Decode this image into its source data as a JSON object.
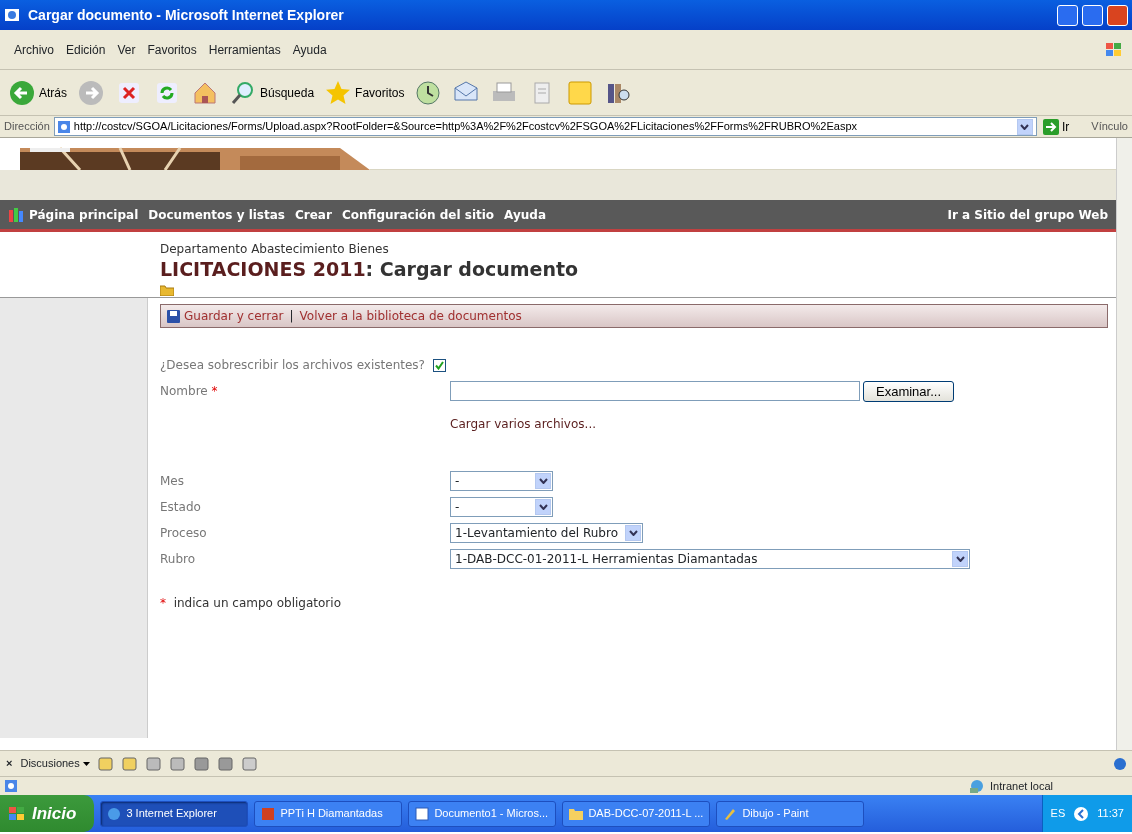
{
  "window": {
    "title": "Cargar documento - Microsoft Internet Explorer"
  },
  "menu": [
    "Archivo",
    "Edición",
    "Ver",
    "Favoritos",
    "Herramientas",
    "Ayuda"
  ],
  "toolbar": [
    {
      "kind": "back",
      "label": "Atrás"
    },
    {
      "kind": "forward"
    },
    {
      "kind": "stop"
    },
    {
      "kind": "refresh"
    },
    {
      "kind": "home"
    },
    {
      "kind": "search",
      "label": "Búsqueda"
    },
    {
      "kind": "favorites",
      "label": "Favoritos"
    },
    {
      "kind": "history"
    },
    {
      "kind": "mail"
    },
    {
      "kind": "print"
    },
    {
      "kind": "edit"
    },
    {
      "kind": "note"
    },
    {
      "kind": "research"
    }
  ],
  "address": {
    "label": "Dirección",
    "url": "http://costcv/SGOA/Licitaciones/Forms/Upload.aspx?RootFolder=&Source=http%3A%2F%2Fcostcv%2FSGOA%2FLicitaciones%2FForms%2FRUBRO%2Easpx",
    "go": "Ir",
    "links": "Vínculo"
  },
  "site_nav": {
    "items": [
      "Página principal",
      "Documentos y listas",
      "Crear",
      "Configuración del sitio",
      "Ayuda"
    ],
    "right_link": "Ir a Sitio del grupo Web"
  },
  "header": {
    "breadcrumb": "Departamento Abastecimiento Bienes",
    "list_name": "LICITACIONES 2011",
    "page_title": ": Cargar documento"
  },
  "actions": [
    "Guardar y cerrar",
    "Volver a la biblioteca de documentos"
  ],
  "overwrite": {
    "label": "¿Desea sobrescribir los archivos existentes?",
    "checked": true
  },
  "name_field": {
    "label": "Nombre",
    "required_mark": "*",
    "button": "Examinar..."
  },
  "upload_multiple": "Cargar varios archivos...",
  "action_separator": "|",
  "selects": [
    {
      "label": "Mes",
      "value": "-"
    },
    {
      "label": "Estado",
      "value": "-"
    },
    {
      "label": "Proceso",
      "value": "1-Levantamiento del Rubro"
    },
    {
      "label": "Rubro",
      "value": "1-DAB-DCC-01-2011-L Herramientas Diamantadas"
    }
  ],
  "required_note": {
    "mark": "*",
    "text": "indica un campo obligatorio"
  },
  "discussion_bar": {
    "close": "×",
    "label": "Discusiones"
  },
  "status_bar": {
    "zone": "Intranet local"
  },
  "taskbar": {
    "start": "Inicio",
    "tasks": [
      {
        "label": "3 Internet Explorer",
        "kind": "ie",
        "selected": true
      },
      {
        "label": "PPTi H Diamantadas",
        "kind": "ppt",
        "selected": false
      },
      {
        "label": "Documento1 - Micros...",
        "kind": "word",
        "selected": false
      },
      {
        "label": "DAB-DCC-07-2011-L ...",
        "kind": "folder",
        "selected": false
      },
      {
        "label": "Dibujo - Paint",
        "kind": "paint",
        "selected": false
      }
    ],
    "language": "ES",
    "clock": "11:37"
  }
}
